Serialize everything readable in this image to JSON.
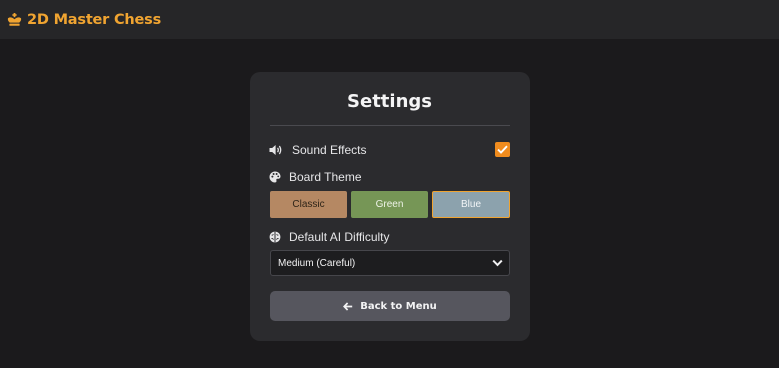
{
  "header": {
    "app_title": "2D Master Chess",
    "brand_icon": "chess-king-icon",
    "accent_color": "#f0a431"
  },
  "settings": {
    "title": "Settings",
    "sound": {
      "label": "Sound Effects",
      "icon": "volume-icon",
      "checked": true
    },
    "theme": {
      "label": "Board Theme",
      "icon": "palette-icon",
      "options": [
        "Classic",
        "Green",
        "Blue"
      ],
      "selected": "Blue"
    },
    "difficulty": {
      "label": "Default AI Difficulty",
      "icon": "brain-icon",
      "selected": "Medium (Careful)"
    },
    "back_button": {
      "label": "Back to Menu",
      "icon": "arrow-left-icon"
    }
  }
}
